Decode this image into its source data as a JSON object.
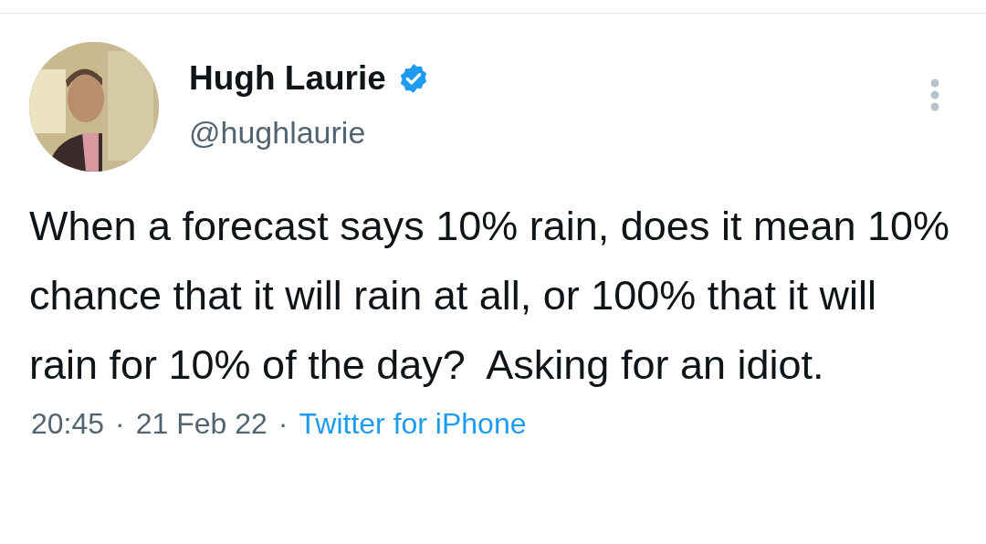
{
  "tweet": {
    "author": {
      "name": "Hugh Laurie",
      "verified": true,
      "handle": "@hughlaurie"
    },
    "text": "When a forecast says 10% rain, does it mean 10% chance that it will rain at all, or 100% that it will rain for 10% of the day?  Asking for an idiot.",
    "meta": [
      {
        "kind": "text",
        "text": "20:45"
      },
      {
        "kind": "separator",
        "text": "·"
      },
      {
        "kind": "text",
        "text": "21 Feb 22"
      },
      {
        "kind": "separator",
        "text": "·"
      },
      {
        "kind": "link",
        "text": "Twitter for iPhone"
      }
    ]
  }
}
